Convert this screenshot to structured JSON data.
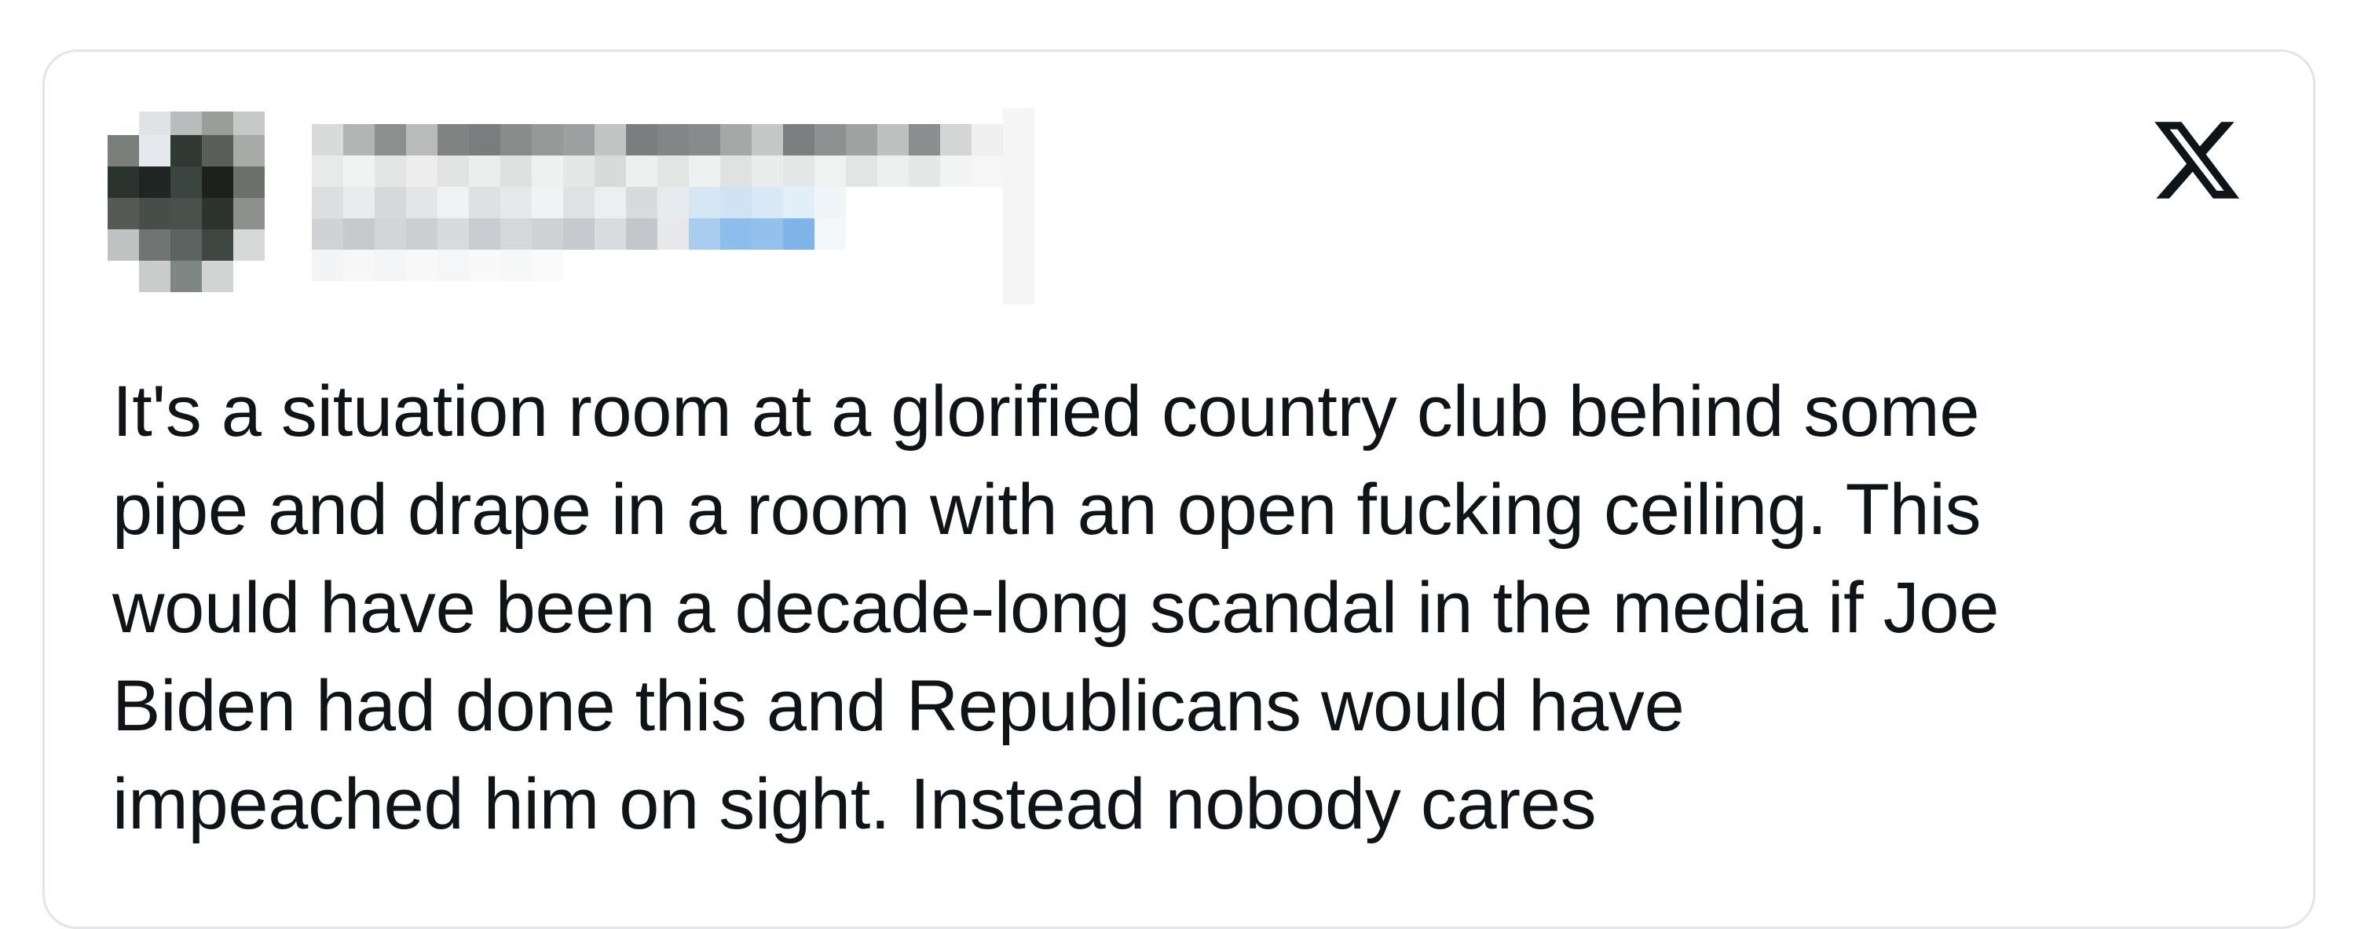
{
  "embed": {
    "brand_icon": "x-logo-icon",
    "author": {
      "display_name_redacted": true,
      "handle_redacted": true,
      "avatar_redacted": true
    },
    "tweet_lines": [
      "It's a situation room at a glorified country club behind some",
      "pipe and drape in a room with an open fucking ceiling. This",
      "would have been a decade-long scandal in the media if Joe",
      "Biden had done this and Republicans would have",
      "impeached him on sight. Instead nobody cares"
    ]
  },
  "colors": {
    "text": "#0f1419",
    "border": "#e1e5e8",
    "link_blue": "#1d9bf0"
  }
}
